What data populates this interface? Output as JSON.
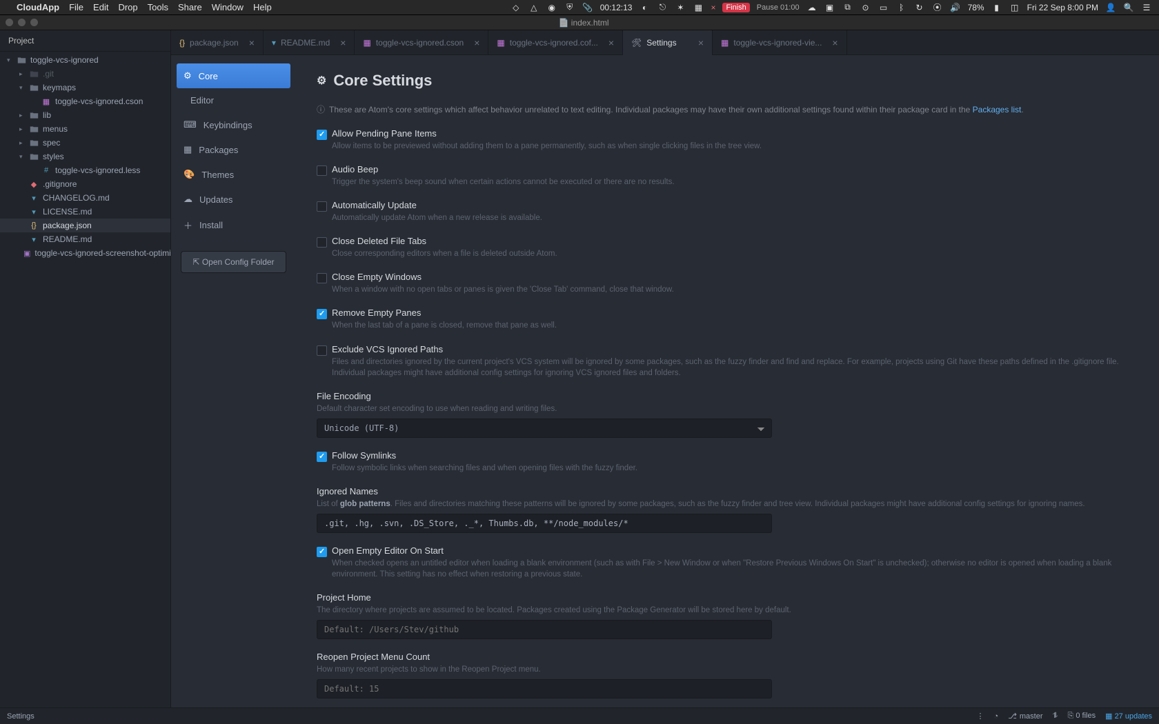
{
  "menubar": {
    "app": "CloudApp",
    "items": [
      "File",
      "Edit",
      "Drop",
      "Tools",
      "Share",
      "Window",
      "Help"
    ],
    "tray": {
      "timer": "00:12:13",
      "finish": "Finish",
      "pause": "Pause 01:00",
      "battery": "78%",
      "clock": "Fri 22 Sep  8:00 PM"
    }
  },
  "window_title": "index.html",
  "project": {
    "header": "Project",
    "root": "toggle-vcs-ignored",
    "tree": [
      {
        "type": "folder",
        "name": ".git",
        "indent": 1,
        "expanded": false,
        "muted": true
      },
      {
        "type": "folder",
        "name": "keymaps",
        "indent": 1,
        "expanded": true
      },
      {
        "type": "file",
        "name": "toggle-vcs-ignored.cson",
        "indent": 2,
        "ico": "cson"
      },
      {
        "type": "folder",
        "name": "lib",
        "indent": 1,
        "expanded": false
      },
      {
        "type": "folder",
        "name": "menus",
        "indent": 1,
        "expanded": false
      },
      {
        "type": "folder",
        "name": "spec",
        "indent": 1,
        "expanded": false
      },
      {
        "type": "folder",
        "name": "styles",
        "indent": 1,
        "expanded": true
      },
      {
        "type": "file",
        "name": "toggle-vcs-ignored.less",
        "indent": 2,
        "ico": "less"
      },
      {
        "type": "file",
        "name": ".gitignore",
        "indent": 1,
        "ico": "git"
      },
      {
        "type": "file",
        "name": "CHANGELOG.md",
        "indent": 1,
        "ico": "md"
      },
      {
        "type": "file",
        "name": "LICENSE.md",
        "indent": 1,
        "ico": "md"
      },
      {
        "type": "file",
        "name": "package.json",
        "indent": 1,
        "ico": "json",
        "selected": true
      },
      {
        "type": "file",
        "name": "README.md",
        "indent": 1,
        "ico": "md"
      },
      {
        "type": "file",
        "name": "toggle-vcs-ignored-screenshot-optimized.gif",
        "indent": 1,
        "ico": "gif"
      }
    ]
  },
  "tabs": [
    {
      "label": "package.json",
      "ico": "json"
    },
    {
      "label": "README.md",
      "ico": "md"
    },
    {
      "label": "toggle-vcs-ignored.cson",
      "ico": "cson"
    },
    {
      "label": "toggle-vcs-ignored.cof...",
      "ico": "cson"
    },
    {
      "label": "Settings",
      "ico": "settings",
      "active": true
    },
    {
      "label": "toggle-vcs-ignored-vie...",
      "ico": "cson"
    }
  ],
  "settings_nav": {
    "items": [
      {
        "label": "Core",
        "icon": "sliders",
        "active": true
      },
      {
        "label": "Editor",
        "icon": "code"
      },
      {
        "label": "Keybindings",
        "icon": "keyboard"
      },
      {
        "label": "Packages",
        "icon": "package"
      },
      {
        "label": "Themes",
        "icon": "paint"
      },
      {
        "label": "Updates",
        "icon": "cloud"
      },
      {
        "label": "Install",
        "icon": "plus"
      }
    ],
    "open_config": "Open Config Folder"
  },
  "settings": {
    "heading": "Core Settings",
    "intro_pre": "These are Atom's core settings which affect behavior unrelated to text editing. Individual packages may have their own additional settings found within their package card in the ",
    "intro_link": "Packages list",
    "items": [
      {
        "id": "allowPending",
        "type": "checkbox",
        "checked": true,
        "title": "Allow Pending Pane Items",
        "desc": "Allow items to be previewed without adding them to a pane permanently, such as when single clicking files in the tree view."
      },
      {
        "id": "audioBeep",
        "type": "checkbox",
        "checked": false,
        "title": "Audio Beep",
        "desc": "Trigger the system's beep sound when certain actions cannot be executed or there are no results."
      },
      {
        "id": "autoUpdate",
        "type": "checkbox",
        "checked": false,
        "title": "Automatically Update",
        "desc": "Automatically update Atom when a new release is available."
      },
      {
        "id": "closeDeleted",
        "type": "checkbox",
        "checked": false,
        "title": "Close Deleted File Tabs",
        "desc": "Close corresponding editors when a file is deleted outside Atom."
      },
      {
        "id": "closeEmpty",
        "type": "checkbox",
        "checked": false,
        "title": "Close Empty Windows",
        "desc": "When a window with no open tabs or panes is given the 'Close Tab' command, close that window."
      },
      {
        "id": "removeEmpty",
        "type": "checkbox",
        "checked": true,
        "title": "Remove Empty Panes",
        "desc": "When the last tab of a pane is closed, remove that pane as well."
      },
      {
        "id": "excludeVcs",
        "type": "checkbox",
        "checked": false,
        "title": "Exclude VCS Ignored Paths",
        "desc": "Files and directories ignored by the current project's VCS system will be ignored by some packages, such as the fuzzy finder and find and replace. For example, projects using Git have these paths defined in the .gitignore file. Individual packages might have additional config settings for ignoring VCS ignored files and folders."
      },
      {
        "id": "fileEncoding",
        "type": "select",
        "title": "File Encoding",
        "desc": "Default character set encoding to use when reading and writing files.",
        "value": "Unicode (UTF-8)"
      },
      {
        "id": "followSymlinks",
        "type": "checkbox",
        "checked": true,
        "title": "Follow Symlinks",
        "desc": "Follow symbolic links when searching files and when opening files with the fuzzy finder."
      },
      {
        "id": "ignoredNames",
        "type": "text",
        "title": "Ignored Names",
        "desc_pre": "List of ",
        "desc_strong": "glob patterns",
        "desc_post": ". Files and directories matching these patterns will be ignored by some packages, such as the fuzzy finder and tree view. Individual packages might have additional config settings for ignoring names.",
        "value": ".git, .hg, .svn, .DS_Store, ._*, Thumbs.db, **/node_modules/*"
      },
      {
        "id": "openEmpty",
        "type": "checkbox",
        "checked": true,
        "title": "Open Empty Editor On Start",
        "desc": "When checked opens an untitled editor when loading a blank environment (such as with File > New Window or when \"Restore Previous Windows On Start\" is unchecked); otherwise no editor is opened when loading a blank environment. This setting has no effect when restoring a previous state."
      },
      {
        "id": "projectHome",
        "type": "text",
        "title": "Project Home",
        "desc": "The directory where projects are assumed to be located. Packages created using the Package Generator will be stored here by default.",
        "placeholder": "Default: /Users/Stev/github",
        "value": ""
      },
      {
        "id": "reopenCount",
        "type": "text",
        "title": "Reopen Project Menu Count",
        "desc": "How many recent projects to show in the Reopen Project menu.",
        "placeholder": "Default: 15",
        "value": ""
      }
    ]
  },
  "status": {
    "left": "Settings",
    "branch": "master",
    "files": "0 files",
    "updates": "27 updates"
  }
}
